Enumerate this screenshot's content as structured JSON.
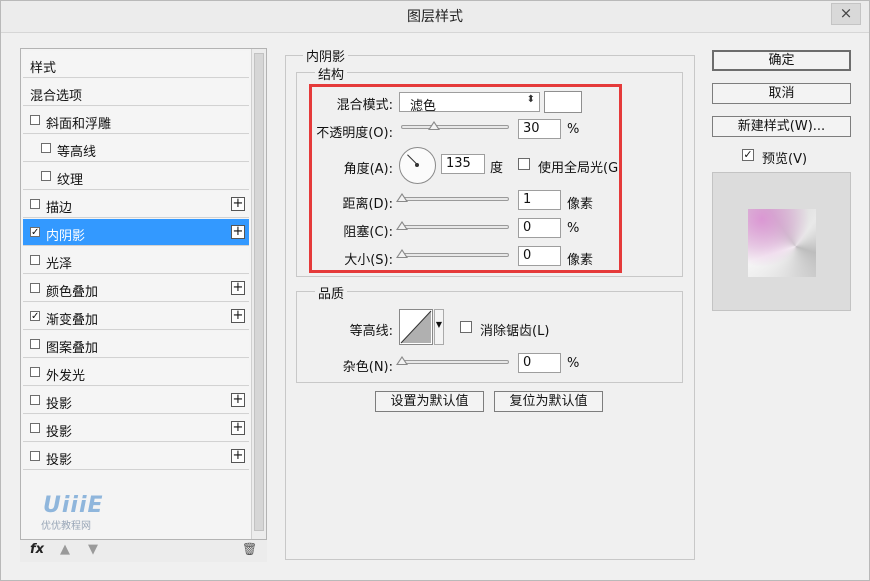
{
  "window": {
    "title": "图层样式",
    "close_glyph": "×"
  },
  "left_list": {
    "items": [
      {
        "label": "样式",
        "checkbox": false,
        "checked": false,
        "plus": false,
        "indent": false,
        "selected": false
      },
      {
        "label": "混合选项",
        "checkbox": false,
        "checked": false,
        "plus": false,
        "indent": false,
        "selected": false
      },
      {
        "label": "斜面和浮雕",
        "checkbox": true,
        "checked": false,
        "plus": false,
        "indent": false,
        "selected": false
      },
      {
        "label": "等高线",
        "checkbox": true,
        "checked": false,
        "plus": false,
        "indent": true,
        "selected": false
      },
      {
        "label": "纹理",
        "checkbox": true,
        "checked": false,
        "plus": false,
        "indent": true,
        "selected": false
      },
      {
        "label": "描边",
        "checkbox": true,
        "checked": false,
        "plus": true,
        "indent": false,
        "selected": false
      },
      {
        "label": "内阴影",
        "checkbox": true,
        "checked": true,
        "plus": true,
        "indent": false,
        "selected": true
      },
      {
        "label": "光泽",
        "checkbox": true,
        "checked": false,
        "plus": false,
        "indent": false,
        "selected": false
      },
      {
        "label": "颜色叠加",
        "checkbox": true,
        "checked": false,
        "plus": true,
        "indent": false,
        "selected": false
      },
      {
        "label": "渐变叠加",
        "checkbox": true,
        "checked": true,
        "plus": true,
        "indent": false,
        "selected": false
      },
      {
        "label": "图案叠加",
        "checkbox": true,
        "checked": false,
        "plus": false,
        "indent": false,
        "selected": false
      },
      {
        "label": "外发光",
        "checkbox": true,
        "checked": false,
        "plus": false,
        "indent": false,
        "selected": false
      },
      {
        "label": "投影",
        "checkbox": true,
        "checked": false,
        "plus": true,
        "indent": false,
        "selected": false
      },
      {
        "label": "投影",
        "checkbox": true,
        "checked": false,
        "plus": true,
        "indent": false,
        "selected": false
      },
      {
        "label": "投影",
        "checkbox": true,
        "checked": false,
        "plus": true,
        "indent": false,
        "selected": false
      }
    ],
    "bottom_icons": {
      "fx": "fx",
      "up": "▲",
      "down": "▼",
      "trash": "🗑"
    }
  },
  "watermark": {
    "logo": "UiiiE",
    "caption": "优优教程网"
  },
  "inner_shadow": {
    "section_title": "内阴影",
    "structure": {
      "title": "结构",
      "blend_mode": {
        "label": "混合模式:",
        "value": "滤色",
        "arrow": "⬍",
        "color": "#ffffff"
      },
      "opacity": {
        "label": "不透明度(O):",
        "value": "30",
        "unit": "%",
        "fraction": 0.3
      },
      "angle": {
        "label": "角度(A):",
        "value": "135",
        "unit": "度",
        "degrees": 135,
        "global_light_label": "使用全局光(G)",
        "global_light_checked": false
      },
      "distance": {
        "label": "距离(D):",
        "value": "1",
        "unit": "像素",
        "fraction": 0.0
      },
      "choke": {
        "label": "阻塞(C):",
        "value": "0",
        "unit": "%",
        "fraction": 0.0
      },
      "size": {
        "label": "大小(S):",
        "value": "0",
        "unit": "像素",
        "fraction": 0.0
      }
    },
    "quality": {
      "title": "品质",
      "contour_label": "等高线:",
      "antialias_label": "消除锯齿(L)",
      "antialias_checked": false,
      "noise": {
        "label": "杂色(N):",
        "value": "0",
        "unit": "%",
        "fraction": 0.0
      }
    },
    "buttons": {
      "set_default": "设置为默认值",
      "reset_default": "复位为默认值"
    }
  },
  "right_panel": {
    "ok": "确定",
    "cancel": "取消",
    "new_style": "新建样式(W)...",
    "preview_label": "预览(V)",
    "preview_checked": true
  },
  "colors": {
    "selection": "#3399ff",
    "highlight": "#e53a3a"
  }
}
